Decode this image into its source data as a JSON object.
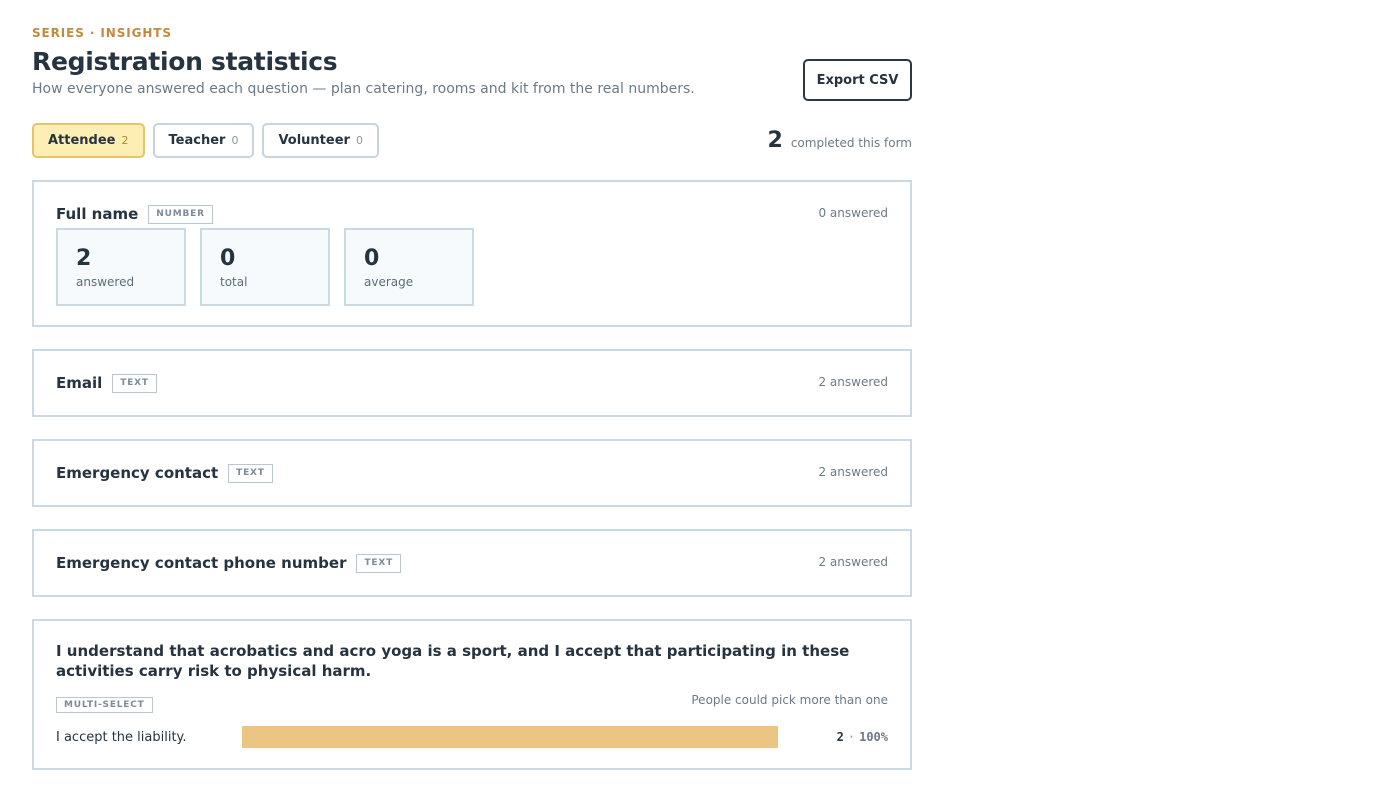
{
  "header": {
    "eyebrow": "SERIES · INSIGHTS",
    "title": "Registration statistics",
    "subtitle": "How everyone answered each question — plan catering, rooms and kit from the real numbers.",
    "export_label": "Export CSV"
  },
  "tabs": [
    {
      "label": "Attendee",
      "count": "2",
      "active": true
    },
    {
      "label": "Teacher",
      "count": "0",
      "active": false
    },
    {
      "label": "Volunteer",
      "count": "0",
      "active": false
    }
  ],
  "completed": {
    "count": "2",
    "label": "completed this form"
  },
  "questions": [
    {
      "title": "Full name",
      "type": "NUMBER",
      "answered": "0 answered",
      "stats": [
        {
          "value": "2",
          "label": "answered"
        },
        {
          "value": "0",
          "label": "total"
        },
        {
          "value": "0",
          "label": "average"
        }
      ]
    },
    {
      "title": "Email",
      "type": "TEXT",
      "answered": "2 answered"
    },
    {
      "title": "Emergency contact",
      "type": "TEXT",
      "answered": "2 answered"
    },
    {
      "title": "Emergency contact phone number",
      "type": "TEXT",
      "answered": "2 answered"
    },
    {
      "title": "I understand that acrobatics and acro yoga is a sport, and I accept that participating in these activities carry risk to physical harm.",
      "type": "MULTI-SELECT",
      "hint": "People could pick more than one",
      "options": [
        {
          "label": "I accept the liability.",
          "count": "2",
          "percent": "100%",
          "fraction": 1.0
        }
      ]
    }
  ],
  "colors": {
    "accent": "#c48a3c",
    "active_tab_bg": "#fdeeb4",
    "bar_fill": "#ecc582",
    "card_border": "#cad9e6"
  }
}
